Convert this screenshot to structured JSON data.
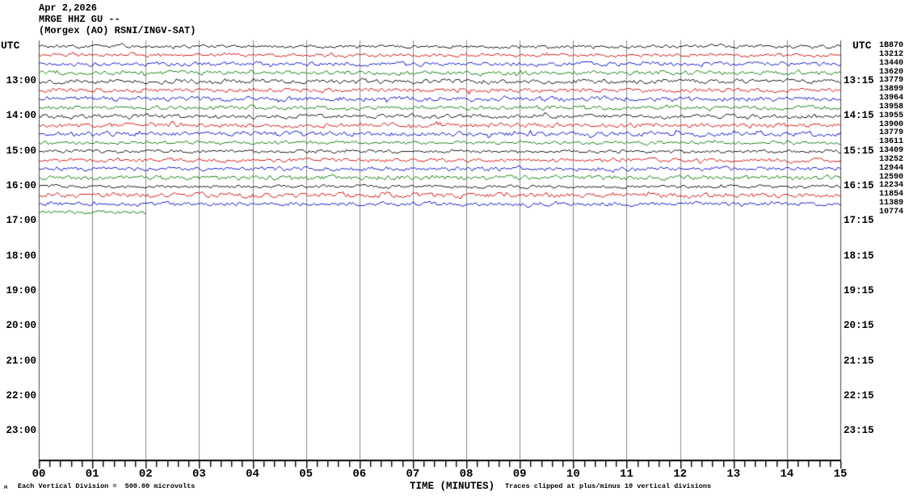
{
  "header": {
    "date": "Apr 2,2026",
    "station": "MRGE HHZ GU --",
    "location": "(Morgex (AO) RSNI/INGV-SAT)"
  },
  "axes": {
    "utc_left": "UTC",
    "utc_right": "UTC",
    "left_hours": [
      "13:00",
      "14:00",
      "15:00",
      "16:00",
      "17:00",
      "18:00",
      "19:00",
      "20:00",
      "21:00",
      "22:00",
      "23:00"
    ],
    "right_hours": [
      "13:15",
      "14:15",
      "15:15",
      "16:15",
      "17:15",
      "18:15",
      "19:15",
      "20:15",
      "21:15",
      "22:15",
      "23:15"
    ],
    "minutes": [
      "00",
      "01",
      "02",
      "03",
      "04",
      "05",
      "06",
      "07",
      "08",
      "09",
      "10",
      "11",
      "12",
      "13",
      "14",
      "15"
    ],
    "x_title": "TIME (MINUTES)"
  },
  "footer": {
    "divisions_note": "Each Vertical Division =  500.00 microvolts",
    "clip_note": "Traces clipped at plus/minus 10 vertical divisions",
    "watermark": "ʍ"
  },
  "chart_data": {
    "type": "line",
    "subtype": "helicorder-seismogram",
    "title": "MRGE HHZ GU -- (Morgex (AO) RSNI/INGV-SAT) Apr 2,2026",
    "x_axis": {
      "label": "TIME (MINUTES)",
      "range_minutes": [
        0,
        15
      ],
      "major_tick_every_min": 1,
      "minor_tick_every_sec": 12
    },
    "y_axis": {
      "left_label": "UTC",
      "right_label": "UTC",
      "left_hour_ticks": [
        "13:00",
        "14:00",
        "15:00",
        "16:00",
        "17:00",
        "18:00",
        "19:00",
        "20:00",
        "21:00",
        "22:00",
        "23:00"
      ],
      "right_hour_ticks": [
        "13:15",
        "14:15",
        "15:15",
        "16:15",
        "17:15",
        "18:15",
        "19:15",
        "20:15",
        "21:15",
        "22:15",
        "23:15"
      ]
    },
    "rows_capacity": 48,
    "row_duration_minutes": 15,
    "volts_per_division": "500.00 microvolts",
    "clip_divisions": 10,
    "grid": "vertical gridlines at every minute",
    "trace_colors": {
      "black": "#000000",
      "red": "#d40000",
      "blue": "#0000cc",
      "green": "#007700"
    },
    "rows": [
      {
        "utc_start": "12:00",
        "color": "black",
        "amplitude_value": "1B870",
        "data_minutes": 15
      },
      {
        "utc_start": "12:15",
        "color": "red",
        "amplitude_value": "13212",
        "data_minutes": 15
      },
      {
        "utc_start": "12:30",
        "color": "blue",
        "amplitude_value": "13440",
        "data_minutes": 15
      },
      {
        "utc_start": "12:45",
        "color": "green",
        "amplitude_value": "13620",
        "data_minutes": 15
      },
      {
        "utc_start": "13:00",
        "color": "black",
        "amplitude_value": "13779",
        "data_minutes": 15
      },
      {
        "utc_start": "13:15",
        "color": "red",
        "amplitude_value": "13899",
        "data_minutes": 15
      },
      {
        "utc_start": "13:30",
        "color": "blue",
        "amplitude_value": "13964",
        "data_minutes": 15
      },
      {
        "utc_start": "13:45",
        "color": "green",
        "amplitude_value": "13958",
        "data_minutes": 15
      },
      {
        "utc_start": "14:00",
        "color": "black",
        "amplitude_value": "13955",
        "data_minutes": 15
      },
      {
        "utc_start": "14:15",
        "color": "red",
        "amplitude_value": "13900",
        "data_minutes": 15
      },
      {
        "utc_start": "14:30",
        "color": "blue",
        "amplitude_value": "13779",
        "data_minutes": 15
      },
      {
        "utc_start": "14:45",
        "color": "green",
        "amplitude_value": "13611",
        "data_minutes": 15
      },
      {
        "utc_start": "15:00",
        "color": "black",
        "amplitude_value": "13409",
        "data_minutes": 15
      },
      {
        "utc_start": "15:15",
        "color": "red",
        "amplitude_value": "13252",
        "data_minutes": 15
      },
      {
        "utc_start": "15:30",
        "color": "blue",
        "amplitude_value": "12944",
        "data_minutes": 15
      },
      {
        "utc_start": "15:45",
        "color": "green",
        "amplitude_value": "12590",
        "data_minutes": 15
      },
      {
        "utc_start": "16:00",
        "color": "black",
        "amplitude_value": "12234",
        "data_minutes": 15
      },
      {
        "utc_start": "16:15",
        "color": "red",
        "amplitude_value": "11854",
        "data_minutes": 15
      },
      {
        "utc_start": "16:30",
        "color": "blue",
        "amplitude_value": "11389",
        "data_minutes": 15
      },
      {
        "utc_start": "16:45",
        "color": "green",
        "amplitude_value": "10774",
        "data_minutes": 2
      }
    ]
  }
}
